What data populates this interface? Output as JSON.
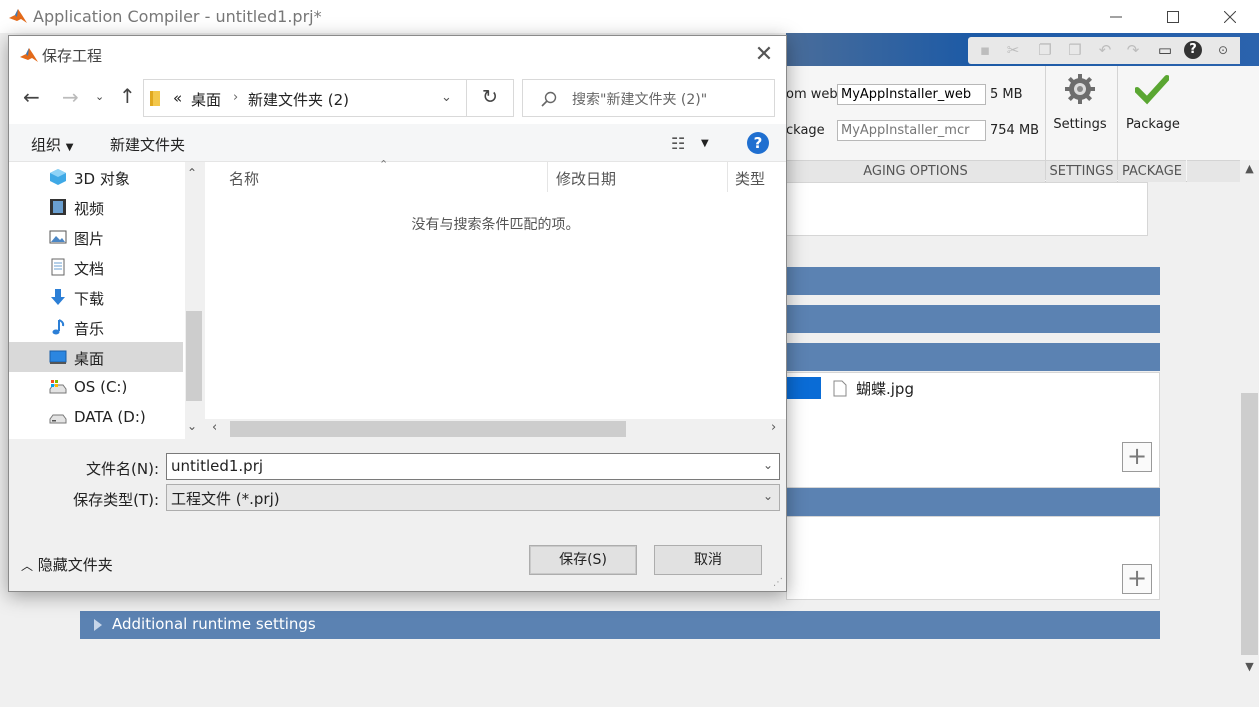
{
  "window": {
    "title": "Application Compiler - untitled1.prj*"
  },
  "ribbon": {
    "web_label": "om web",
    "web_value": "MyAppInstaller_web",
    "web_size": "5 MB",
    "mcr_label": "ckage",
    "mcr_value": "MyAppInstaller_mcr",
    "mcr_size": "754 MB",
    "settings_label": "Settings",
    "package_label": "Package",
    "section_packaging": "AGING OPTIONS",
    "section_settings": "SETTINGS",
    "section_package": "PACKAGE"
  },
  "main": {
    "file_name": "蝴蝶.jpg",
    "additional_runtime": "Additional runtime settings"
  },
  "dialog": {
    "title": "保存工程",
    "breadcrumb": [
      "«",
      "桌面",
      "新建文件夹 (2)"
    ],
    "search_placeholder": "搜索\"新建文件夹 (2)\"",
    "toolbar": {
      "organize": "组织",
      "new_folder": "新建文件夹"
    },
    "tree": [
      {
        "label": "3D 对象",
        "icon": "3d-objects-icon"
      },
      {
        "label": "视频",
        "icon": "video-icon"
      },
      {
        "label": "图片",
        "icon": "pictures-icon"
      },
      {
        "label": "文档",
        "icon": "documents-icon"
      },
      {
        "label": "下载",
        "icon": "download-icon"
      },
      {
        "label": "音乐",
        "icon": "music-icon"
      },
      {
        "label": "桌面",
        "icon": "desktop-icon",
        "selected": true
      },
      {
        "label": "OS (C:)",
        "icon": "drive-c-icon"
      },
      {
        "label": "DATA (D:)",
        "icon": "drive-d-icon"
      }
    ],
    "columns": {
      "name": "名称",
      "modified": "修改日期",
      "type": "类型"
    },
    "empty_message": "没有与搜索条件匹配的项。",
    "filename_label": "文件名(N):",
    "filename_value": "untitled1.prj",
    "filetype_label": "保存类型(T):",
    "filetype_value": "工程文件 (*.prj)",
    "hide_folders": "隐藏文件夹",
    "save_button": "保存(S)",
    "cancel_button": "取消"
  },
  "colors": {
    "section_bar": "#5b82b2",
    "selection": "#cce4f7",
    "accent": "#1f6fd0"
  }
}
